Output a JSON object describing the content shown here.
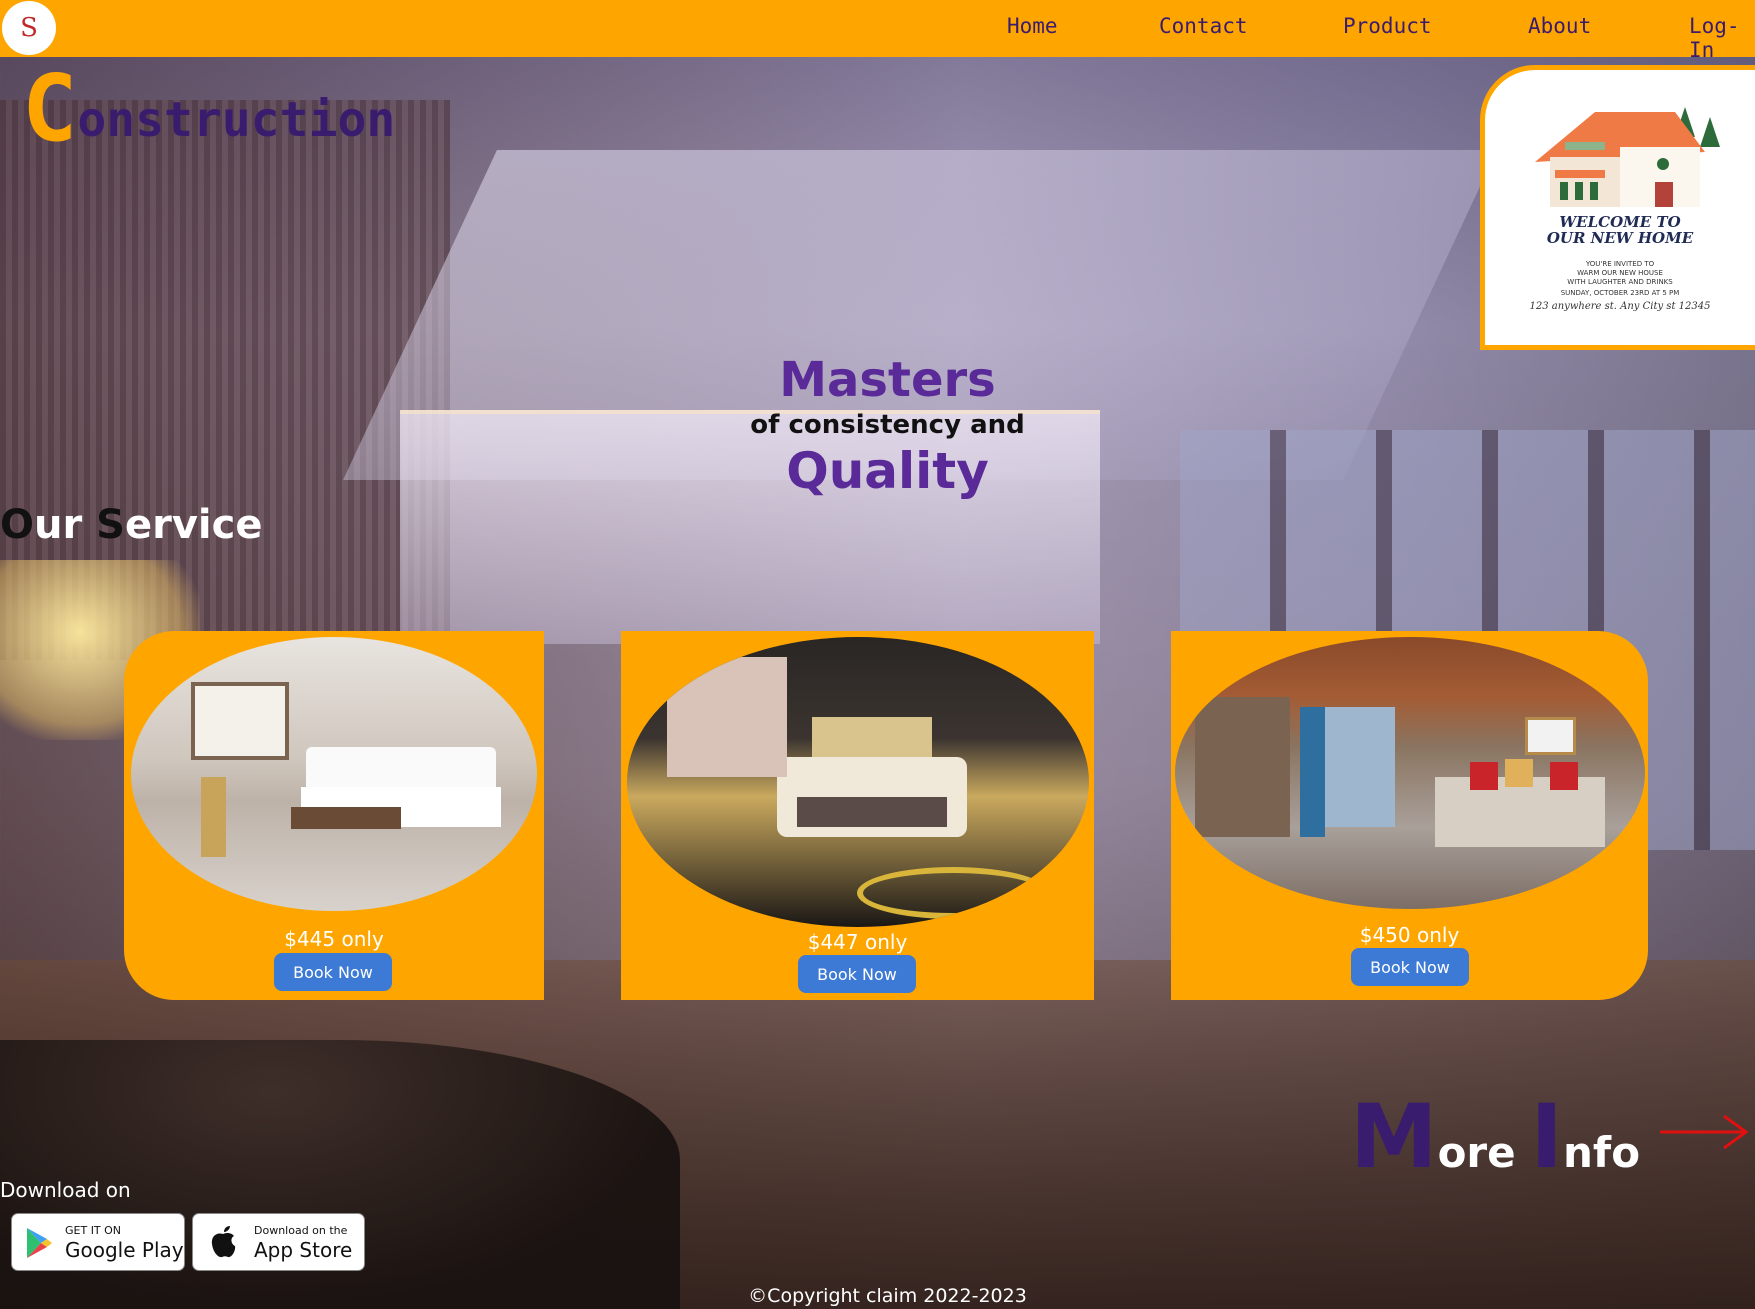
{
  "nav": {
    "logo": "S",
    "links": [
      "Home",
      "Contact",
      "Product",
      "About",
      "Log-In"
    ]
  },
  "hero": {
    "title_first": "C",
    "title_rest": "onstruction",
    "headline_top": "Masters",
    "headline_mid": "of consistency and",
    "headline_bottom": "Quality"
  },
  "invite": {
    "title_line1": "WELCOME TO",
    "title_line2": "OUR NEW HOME",
    "line1": "YOU'RE INVITED TO",
    "line2": "WARM OUR NEW HOUSE",
    "line3": "WITH LAUGHTER AND DRINKS",
    "line4": "SUNDAY, OCTOBER 23RD AT 5 PM",
    "signature": "123 anywhere st. Any City st 12345"
  },
  "services": {
    "heading_first": "O",
    "heading_mid": "ur ",
    "heading_s": "S",
    "heading_rest": "ervice",
    "cards": [
      {
        "price": "$445 only",
        "button": "Book Now"
      },
      {
        "price": "$447 only",
        "button": "Book Now"
      },
      {
        "price": "$450 only",
        "button": "Book Now"
      }
    ]
  },
  "more_info": {
    "first": "M",
    "mid": "ore ",
    "second": "I",
    "rest": "nfo"
  },
  "download": {
    "label": "Download on",
    "google_small": "GET IT ON",
    "google_big": "Google Play",
    "apple_small": "Download on the",
    "apple_big": "App Store"
  },
  "footer": {
    "copyright": "©Copyright claim 2022-2023"
  },
  "colors": {
    "accent": "#ffa500",
    "brand_purple": "#3a1c6e",
    "button_blue": "#3d7ad6"
  }
}
